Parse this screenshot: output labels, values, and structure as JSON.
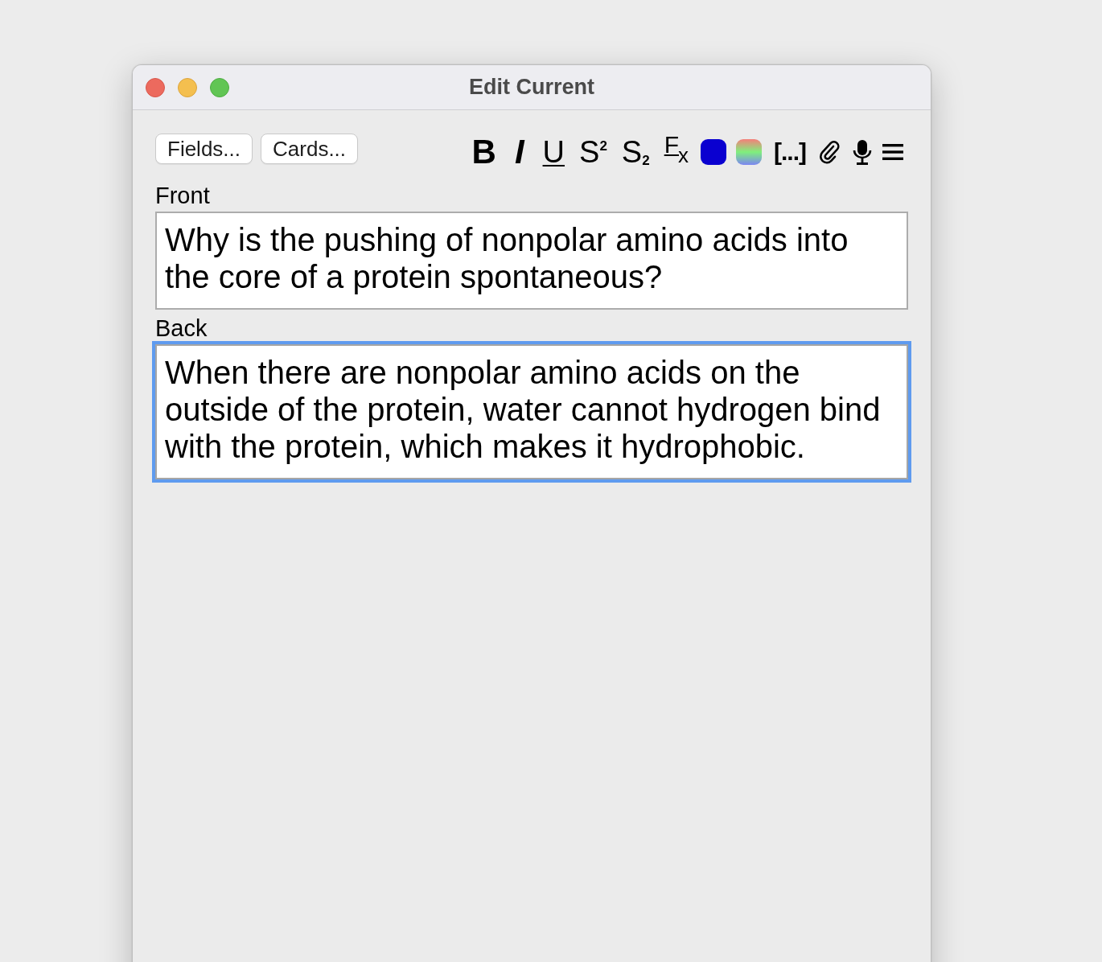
{
  "window": {
    "title": "Edit Current"
  },
  "toolbar": {
    "buttons": [
      {
        "label": "Fields..."
      },
      {
        "label": "Cards..."
      }
    ],
    "format_buttons": [
      {
        "kind": "bold",
        "label": "B"
      },
      {
        "kind": "italic",
        "label": "I"
      },
      {
        "kind": "underline",
        "label": "U"
      },
      {
        "kind": "superscript",
        "label": "S$^{2}$"
      },
      {
        "kind": "subscript",
        "label": "S$_{2}$"
      },
      {
        "kind": "clear",
        "label": "F$_{x}$"
      },
      {
        "kind": "color",
        "color": "#0a00d0"
      },
      {
        "kind": "highlight"
      },
      {
        "kind": "cloze",
        "label": "[...]"
      },
      {
        "kind": "attach"
      },
      {
        "kind": "record"
      },
      {
        "kind": "menu"
      }
    ]
  },
  "fields": [
    {
      "label": "Front",
      "value": "Why is the pushing of nonpolar amino acids into the core of a protein spontaneous?",
      "focused": false
    },
    {
      "label": "Back",
      "value": "When there are nonpolar amino acids on the outside of the protein, water cannot hydrogen bind with the protein, which makes it hydrophobic.",
      "focused": true
    }
  ]
}
